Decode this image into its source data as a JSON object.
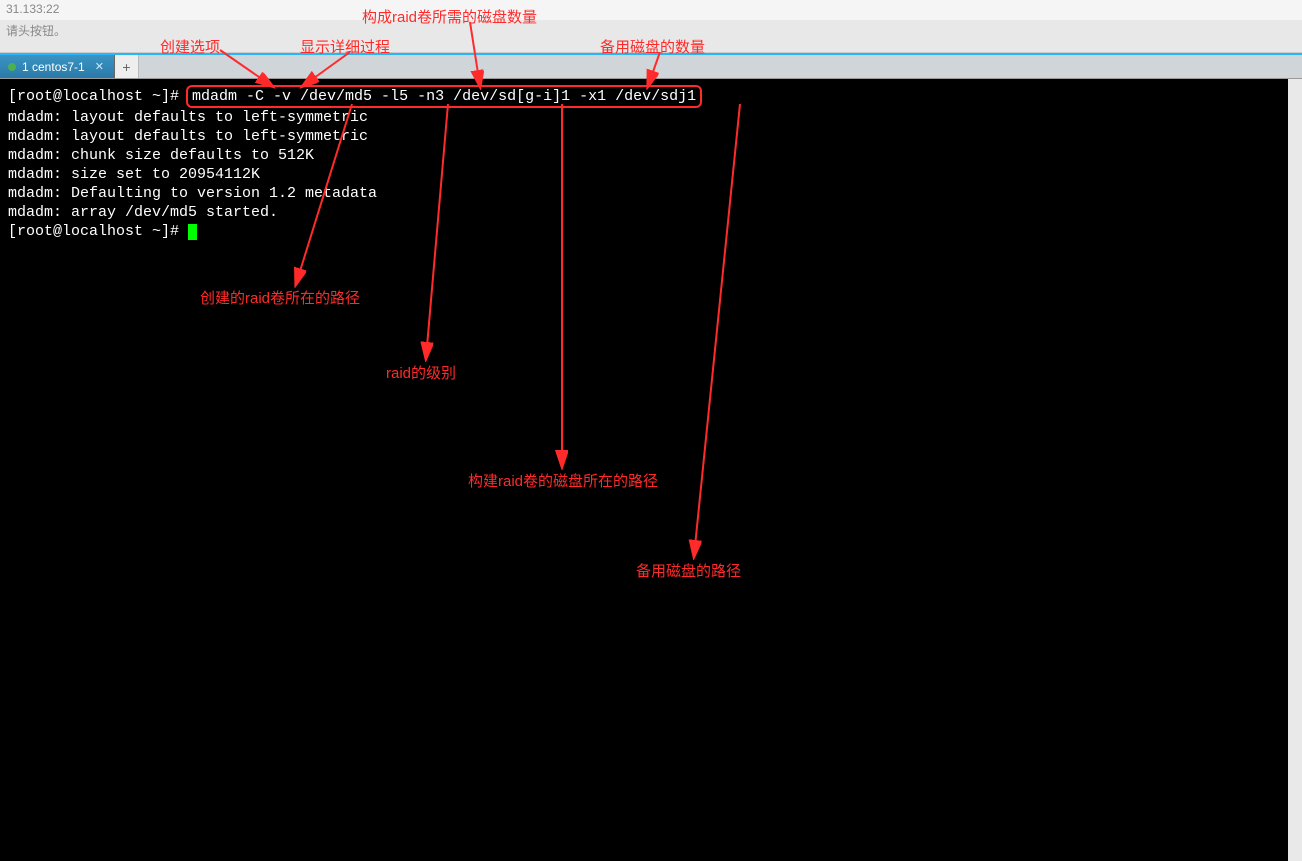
{
  "titlebar": {
    "text": "31.133:22"
  },
  "toolbar": {
    "hint_text": "请头按钮。"
  },
  "tabs": {
    "items": [
      {
        "label": "1 centos7-1"
      }
    ]
  },
  "terminal": {
    "prompt": "[root@localhost ~]# ",
    "command": "mdadm -C -v /dev/md5 -l5 -n3 /dev/sd[g-i]1 -x1 /dev/sdj1",
    "output_lines": [
      "mdadm: layout defaults to left-symmetric",
      "mdadm: layout defaults to left-symmetric",
      "mdadm: chunk size defaults to 512K",
      "mdadm: size set to 20954112K",
      "mdadm: Defaulting to version 1.2 metadata",
      "mdadm: array /dev/md5 started."
    ],
    "prompt2": "[root@localhost ~]# "
  },
  "annotations": {
    "create_option": "创建选项",
    "verbose": "显示详细过程",
    "disk_count": "构成raid卷所需的磁盘数量",
    "spare_count": "备用磁盘的数量",
    "raid_path": "创建的raid卷所在的路径",
    "raid_level": "raid的级别",
    "disk_path": "构建raid卷的磁盘所在的路径",
    "spare_path": "备用磁盘的路径"
  }
}
